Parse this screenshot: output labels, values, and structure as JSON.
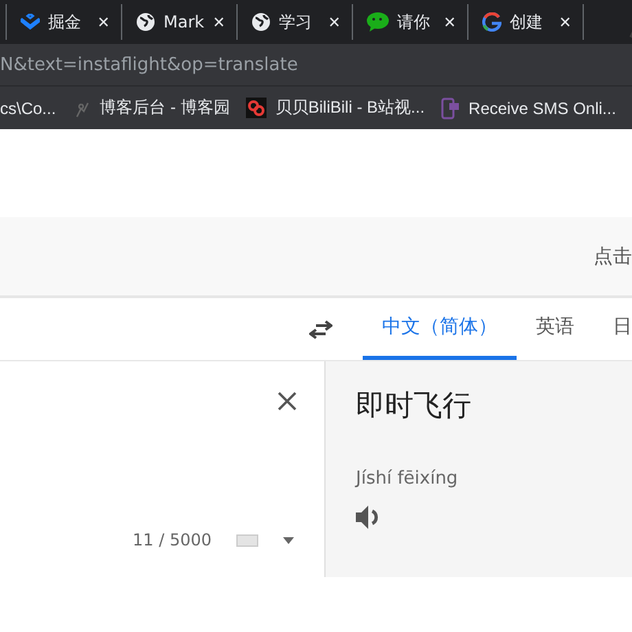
{
  "browser": {
    "tabs": [
      {
        "title": "掘金",
        "close": "✕"
      },
      {
        "title": "Mark",
        "close": "✕"
      },
      {
        "title": "学习",
        "close": "✕"
      },
      {
        "title": "请你",
        "close": "✕"
      },
      {
        "title": "创建",
        "close": "✕"
      }
    ],
    "address": "N&text=instaflight&op=translate",
    "bookmarks": [
      {
        "title": "cs\\Co..."
      },
      {
        "title": "博客后台 - 博客园"
      },
      {
        "title": "贝贝BiliBili - B站视..."
      },
      {
        "title": "Receive SMS Onli..."
      }
    ]
  },
  "banner": {
    "text": "点击"
  },
  "languages": [
    {
      "label": "中文（简体）",
      "selected": true
    },
    {
      "label": "英语",
      "selected": false
    },
    {
      "label": "日",
      "selected": false
    }
  ],
  "source": {
    "counter": "11 / 5000"
  },
  "result": {
    "text": "即时飞行",
    "romanization": "Jíshí fēixíng"
  }
}
